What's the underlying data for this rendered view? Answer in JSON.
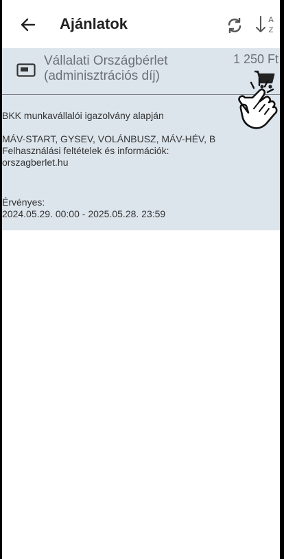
{
  "header": {
    "title": "Ajánlatok",
    "sort_label_top": "A",
    "sort_label_bottom": "Z"
  },
  "offer": {
    "name_line1": "Vállalati Országbérlet",
    "name_line2": "(adminisztrációs díj)",
    "price": "1 250 Ft",
    "description_line1": "BKK munkavállalói igazolvány alapján",
    "description_line2": "MÁV-START, GYSEV, VOLÁNBUSZ, MÁV-HÉV, B",
    "description_line3": "Felhasználási feltételek és információk:",
    "description_line4": "orszagberlet.hu",
    "validity_label": "Érvényes:",
    "validity_range": "2024.05.29. 00:00 - 2025.05.28. 23:59"
  },
  "colors": {
    "card_background": "#dde5ec",
    "muted_text": "#6b7076",
    "icon": "#222222"
  },
  "icons": {
    "back": "arrow-left-icon",
    "refresh": "refresh-icon",
    "sort": "sort-az-icon",
    "ticket": "ticket-icon",
    "cart": "shopping-cart-icon",
    "cursor": "hand-pointer-icon"
  }
}
